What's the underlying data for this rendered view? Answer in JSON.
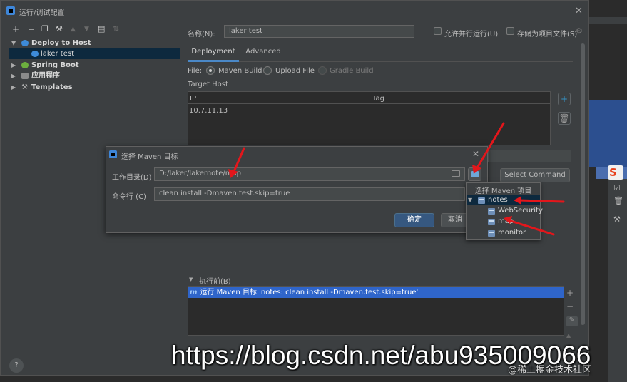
{
  "window": {
    "title": "运行/调试配置",
    "close": "✕"
  },
  "toolbar": {
    "add": "+",
    "remove": "−",
    "copy": "❐",
    "edit": "⚒",
    "up": "▲",
    "down": "▼",
    "folder": "▤",
    "sort": "⇅"
  },
  "tree": {
    "items": [
      {
        "label": "Deploy to Host",
        "expanded": true,
        "icon": "cloud-icon",
        "color": "#3e8bd8"
      },
      {
        "label": "laker test",
        "selected": true,
        "icon": "cloud-icon",
        "color": "#3e8bd8"
      },
      {
        "label": "Spring Boot",
        "expanded": false,
        "icon": "spring-boot-icon",
        "color": "#6cae3e"
      },
      {
        "label": "应用程序",
        "expanded": false,
        "icon": "application-icon",
        "color": "#a0a0a0"
      },
      {
        "label": "Templates",
        "expanded": false,
        "icon": "wrench-icon",
        "color": "#a0a0a0"
      }
    ],
    "help": "?"
  },
  "config": {
    "name_label": "名称(N):",
    "name_value": "laker test",
    "parallel_label": "允许并行运行(U)",
    "store_label": "存储为项目文件(S)",
    "tabs": [
      {
        "label": "Deployment",
        "active": true
      },
      {
        "label": "Advanced",
        "active": false
      }
    ],
    "file_label": "File:",
    "file_options": [
      "Maven Build",
      "Upload File",
      "Gradle Build"
    ],
    "target_host_label": "Target Host",
    "host_columns": [
      "IP",
      "Tag"
    ],
    "host_rows": [
      {
        "ip": "10.7.11.13",
        "tag": ""
      }
    ],
    "before_launch_label": "执行前(B)",
    "before_launch_item": "运行 Maven 目标 'notes: clean install  -Dmaven.test.skip=true'"
  },
  "maven_dialog": {
    "title": "选择 Maven 目标",
    "close": "✕",
    "workdir_label": "工作目录(D)",
    "workdir_value": "D:/laker/lakernote/map",
    "cmd_label": "命令行 (C)",
    "cmd_value": "clean install  -Dmaven.test.skip=true",
    "ok_label": "确定",
    "cancel_label": "取消"
  },
  "select_command_label": "Select Command",
  "maven_popup": {
    "title": "选择 Maven 项目",
    "root": "notes",
    "children": [
      "WebSecurity",
      "map",
      "monitor"
    ]
  },
  "watermark": {
    "url": "https://blog.csdn.net/abu935009066",
    "juejin": "@稀土掘金技术社区"
  },
  "sogou_glyph": "S",
  "colors": {
    "accent": "#2f65ca",
    "tab_underline": "#4a88c7",
    "annotation_red": "#e3161b"
  }
}
